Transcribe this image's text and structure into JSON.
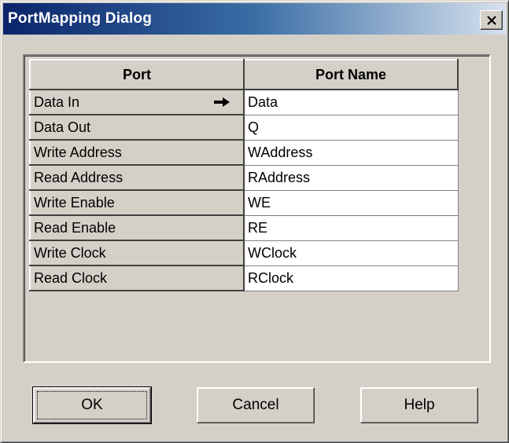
{
  "window": {
    "title": "PortMapping Dialog",
    "close_icon": "close-x-icon"
  },
  "grid": {
    "columns": [
      "Port",
      "Port Name"
    ],
    "rows": [
      {
        "port": "Data In",
        "name": "Data",
        "current": true
      },
      {
        "port": "Data Out",
        "name": "Q"
      },
      {
        "port": "Write Address",
        "name": "WAddress"
      },
      {
        "port": "Read Address",
        "name": "RAddress"
      },
      {
        "port": "Write Enable",
        "name": "WE"
      },
      {
        "port": "Read Enable",
        "name": "RE"
      },
      {
        "port": "Write Clock",
        "name": "WClock"
      },
      {
        "port": "Read Clock",
        "name": "RClock"
      }
    ],
    "current_row_icon": "right-arrow-icon"
  },
  "buttons": {
    "ok": "OK",
    "cancel": "Cancel",
    "help": "Help"
  }
}
